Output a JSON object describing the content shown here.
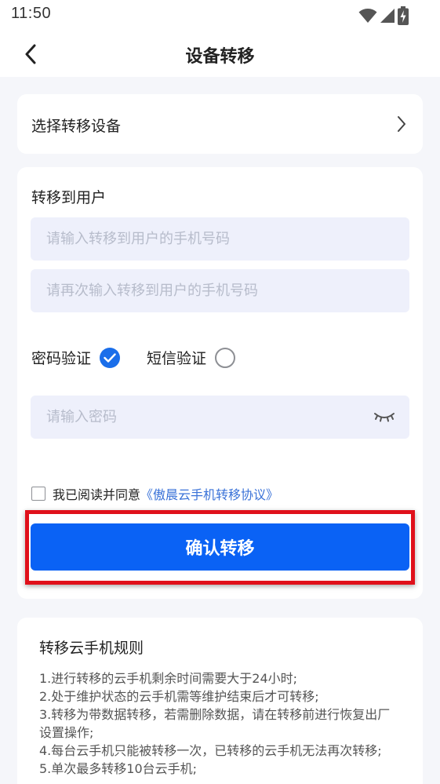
{
  "status_bar": {
    "time": "11:50",
    "icons": [
      "wifi-icon",
      "cell-signal-icon",
      "battery-charging-icon"
    ]
  },
  "nav": {
    "back_icon": "chevron-left-icon",
    "title": "设备转移"
  },
  "select_device": {
    "label": "选择转移设备",
    "arrow_icon": "chevron-right-icon"
  },
  "transfer": {
    "section_label": "转移到用户",
    "phone_placeholder": "请输入转移到用户的手机号码",
    "phone_confirm_placeholder": "请再次输入转移到用户的手机号码",
    "verify_options": [
      {
        "label": "密码验证",
        "selected": true
      },
      {
        "label": "短信验证",
        "selected": false
      }
    ],
    "password_placeholder": "请输入密码",
    "password_toggle_icon": "eye-closed-icon",
    "agreement_prefix": "我已阅读并同意",
    "agreement_link": "《傲晨云手机转移协议》",
    "agreement_checked": false,
    "confirm_label": "确认转移"
  },
  "rules": {
    "title": "转移云手机规则",
    "items": [
      "1.进行转移的云手机剩余时间需要大于24小时;",
      "2.处于维护状态的云手机需等维护结束后才可转移;",
      "3.转移为带数据转移，若需删除数据，请在转移前进行恢复出厂设置操作;",
      "4.每台云手机只能被转移一次，已转移的云手机无法再次转移;",
      "5.单次最多转移10台云手机;"
    ]
  },
  "colors": {
    "accent": "#0a62f5",
    "link": "#3a72d8",
    "highlight": "#e0101a",
    "input_bg": "#eef0fb",
    "page_bg": "#f5f6fa"
  }
}
